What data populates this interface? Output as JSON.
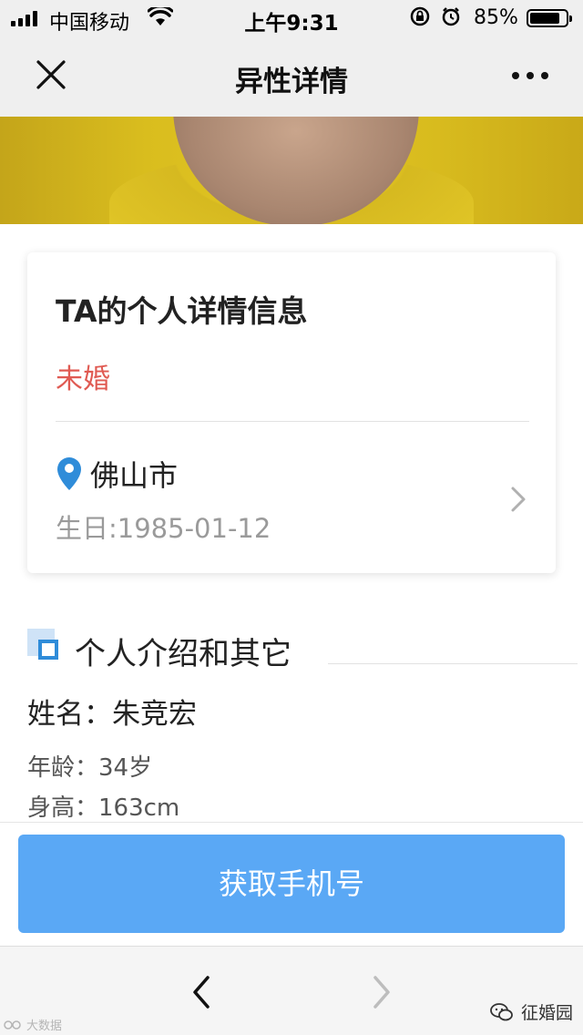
{
  "status_bar": {
    "carrier": "中国移动",
    "time": "上午9:31",
    "battery_pct": "85%",
    "battery_level": 0.85,
    "icons": [
      "signal-icon",
      "wifi-icon",
      "rotation-lock-icon",
      "alarm-icon",
      "battery-icon"
    ]
  },
  "nav": {
    "title": "异性详情",
    "close_icon": "close-icon",
    "more_icon": "more-icon"
  },
  "card": {
    "title": "TA的个人详情信息",
    "marital_status": "未婚",
    "city": "佛山市",
    "birthday": "生日:1985-01-12"
  },
  "section": {
    "title": "个人介绍和其它",
    "name": "姓名：朱竞宏",
    "age": "年龄：34岁",
    "height": "身高：163cm"
  },
  "cta": {
    "label": "获取手机号"
  },
  "watermarks": {
    "left": "大数据",
    "right": "征婚园"
  },
  "colors": {
    "accent_blue": "#5aa8f5",
    "marital_red": "#e05a52",
    "pin_blue": "#2f8cd9"
  }
}
